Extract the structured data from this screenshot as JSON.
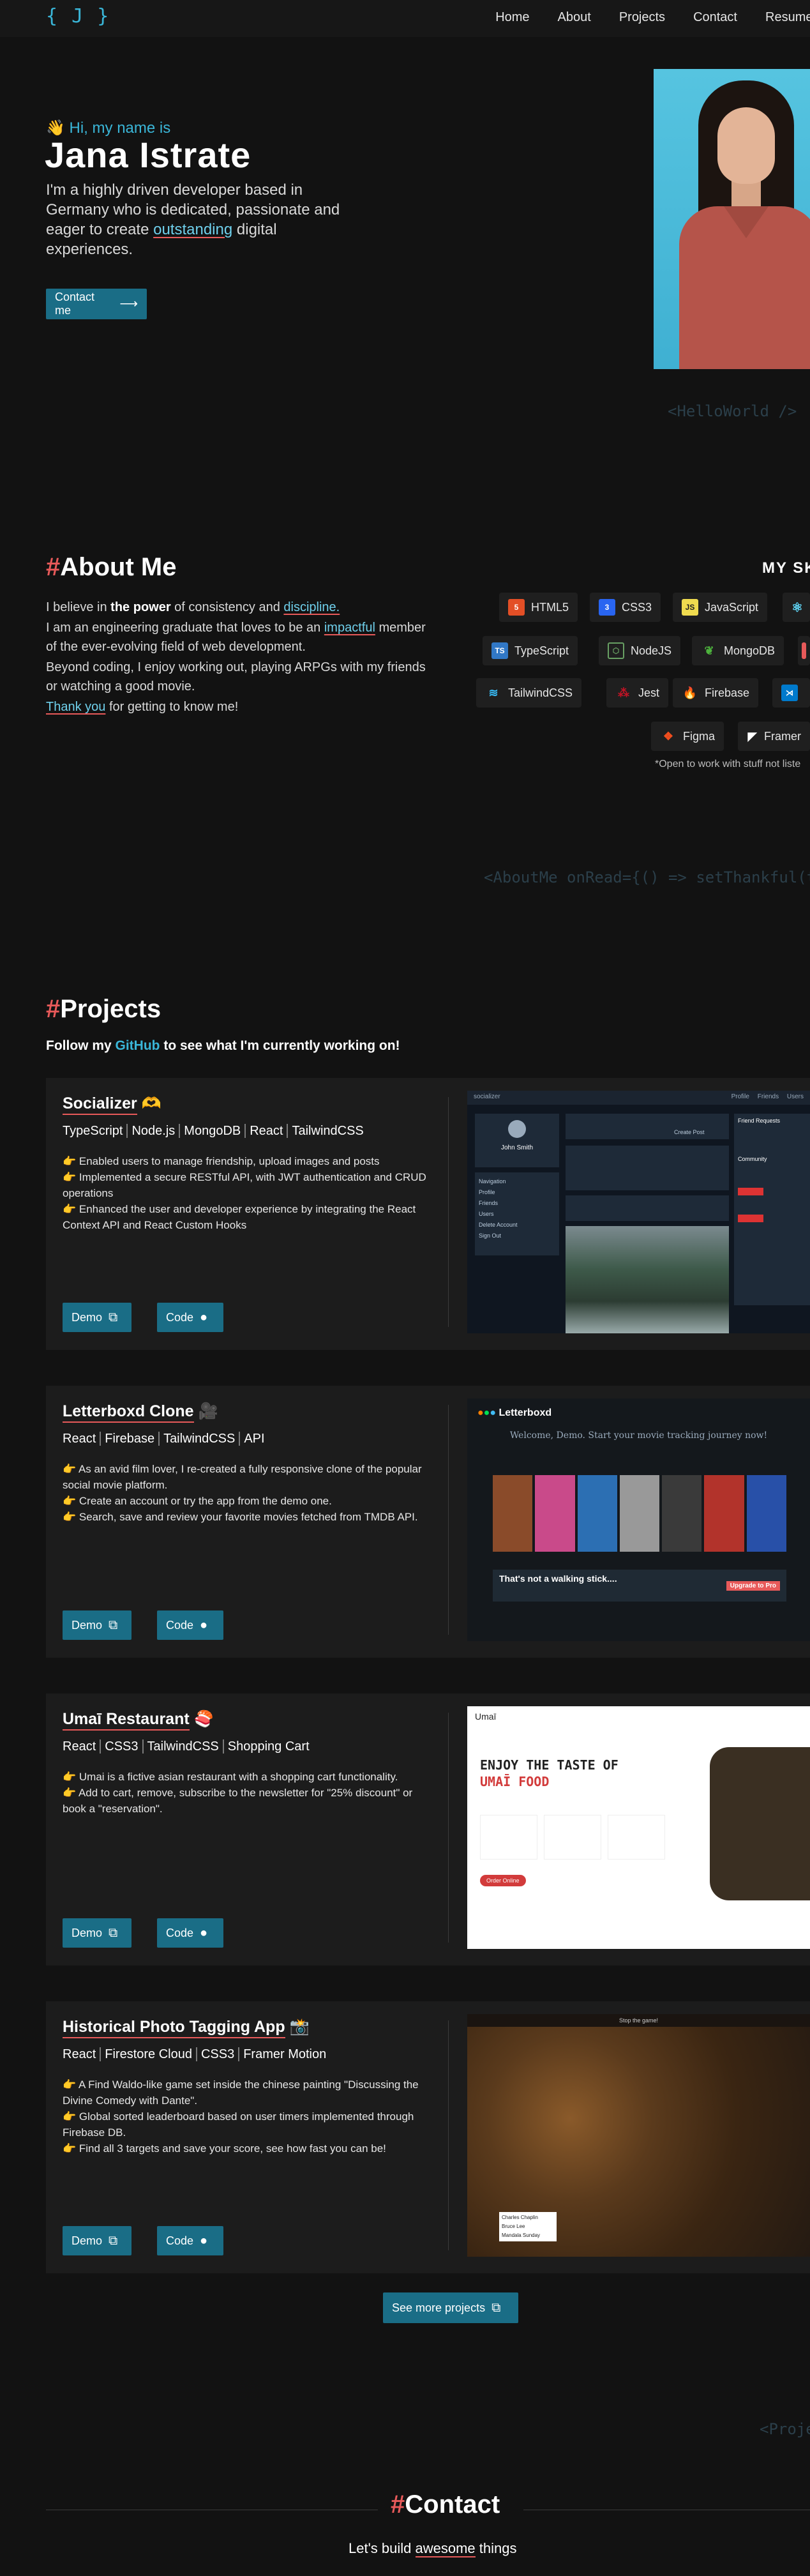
{
  "nav": {
    "logo": "{ J }",
    "links": [
      "Home",
      "About",
      "Projects",
      "Contact",
      "Resume"
    ]
  },
  "hero": {
    "greeting": "👋 Hi, my name is",
    "name": "Jana Istrate",
    "intro_before": "I'm a highly driven developer based in Germany who is dedicated, passionate and eager to create ",
    "intro_highlight": "outstanding",
    "intro_after": " digital experiences.",
    "contact_button": "Contact me",
    "code_tag": "<HelloWorld />"
  },
  "about": {
    "hash": "#",
    "title": "About Me",
    "p1_before": "I believe in ",
    "p1_bold": "the power",
    "p1_mid": " of consistency and ",
    "p1_link": "discipline.",
    "p2_before": "I am an engineering graduate that loves to be an ",
    "p2_link": "impactful",
    "p2_after": " member of the ever-evolving field of web development.",
    "p3": "Beyond coding, I enjoy working out, playing ARPGs with my friends or watching a good movie.",
    "p4_link": "Thank you",
    "p4_after": " for getting to know me!",
    "skills_title": "MY SK",
    "skills": [
      "HTML5",
      "CSS3",
      "JavaScript",
      "TypeScript",
      "NodeJS",
      "MongoDB",
      "TailwindCSS",
      "Jest",
      "Firebase",
      "Figma",
      "Framer"
    ],
    "skills_note": "*Open to work with stuff not liste",
    "code_tag": "<AboutMe onRead={() => setThankful(tru"
  },
  "projects": {
    "hash": "#",
    "title": "Projects",
    "follow_before": "Follow my ",
    "follow_link": "GitHub",
    "follow_after": " to see what I'm currently working on!",
    "demo_label": "Demo",
    "code_label": "Code",
    "items": [
      {
        "title": "Socializer",
        "emoji": "🫶",
        "tags": [
          "TypeScript",
          "Node.js",
          "MongoDB",
          "React",
          "TailwindCSS"
        ],
        "desc": [
          "👉 Enabled users to manage friendship, upload images and posts",
          "👉 Implemented a secure RESTful API, with JWT authentication and CRUD operations",
          "👉 Enhanced the user and developer experience by integrating the React Context API and React Custom Hooks"
        ]
      },
      {
        "title": "Letterboxd Clone",
        "emoji": "🎥",
        "tags": [
          "React",
          "Firebase",
          "TailwindCSS",
          "API"
        ],
        "desc": [
          "👉 As an avid film lover, I re-created a fully responsive clone of the popular social movie platform.",
          "👉 Create an account or try the app from the demo one.",
          "👉 Search, save and review your favorite movies fetched from TMDB API."
        ]
      },
      {
        "title": "Umaī Restaurant",
        "emoji": "🍣",
        "tags": [
          "React",
          "CSS3",
          "TailwindCSS",
          "Shopping Cart"
        ],
        "desc": [
          "👉 Umai is a fictive asian restaurant with a shopping cart functionality.",
          "👉 Add to cart, remove, subscribe to the newsletter for \"25% discount\" or book a \"reservation\"."
        ]
      },
      {
        "title": "Historical Photo Tagging App",
        "emoji": "📸",
        "tags": [
          "React",
          "Firestore Cloud",
          "CSS3",
          "Framer Motion"
        ],
        "desc": [
          "👉 A Find Waldo-like game set inside the chinese painting \"Discussing the Divine Comedy with Dante\".",
          "👉 Global sorted leaderboard based on user timers implemented through Firebase DB.",
          "👉 Find all 3 targets and save your score, see how fast you can be!"
        ]
      }
    ],
    "see_more": "See more projects",
    "code_tag": "<Proje"
  },
  "shots": {
    "socializer": {
      "brand": "socializer",
      "user": "John Smith",
      "nav": [
        "Profile",
        "Friends",
        "Users"
      ],
      "requests": "Friend Requests",
      "community": "Community",
      "menu": [
        "Navigation",
        "Profile",
        "Friends",
        "Users",
        "Delete Account",
        "Sign Out"
      ],
      "composer": "Create Post"
    },
    "letterboxd": {
      "brand": "Letterboxd",
      "welcome": "Welcome, Demo. Start your movie tracking journey now!",
      "banner": "That's not a walking stick....",
      "upgrade": "Upgrade to Pro"
    },
    "umai": {
      "brand": "Umaī",
      "headline1": "ENJOY THE TASTE OF",
      "headline2": "UMAĪ FOOD",
      "cta": "Order Online"
    },
    "tagging": {
      "header": "Stop the game!",
      "targets": [
        "Charles Chaplin",
        "Bruce Lee",
        "Mandala Sunday"
      ]
    }
  },
  "contact": {
    "hash": "#",
    "title": "Contact",
    "sub_before": "Let's build ",
    "sub_highlight": "awesome",
    "sub_after": " things"
  }
}
